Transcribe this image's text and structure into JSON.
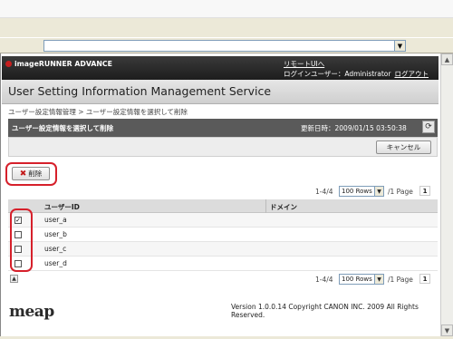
{
  "browser": {
    "address_value": ""
  },
  "header": {
    "logo": "imageRUNNER ADVANCE",
    "remote_link": "リモートUIへ",
    "login_label": "ログインユーザー：Administrator",
    "logout_link": "ログアウト"
  },
  "service_title": "User Setting Information Management Service",
  "breadcrumb": "ユーザー設定情報管理 > ユーザー設定情報を選択して削除",
  "panel": {
    "title": "ユーザー設定情報を選択して削除",
    "updated": "更新日時：2009/01/15 03:50:38",
    "cancel_label": "キャンセル"
  },
  "delete_label": "削除",
  "pager": {
    "range": "1-4/4",
    "rows": "100 Rows",
    "pages": "/1 Page",
    "current": "1"
  },
  "table": {
    "columns": [
      "ユーザーID",
      "ドメイン"
    ],
    "rows": [
      {
        "user_id": "user_a",
        "domain": "",
        "checked": "✓"
      },
      {
        "user_id": "user_b",
        "domain": "",
        "checked": ""
      },
      {
        "user_id": "user_c",
        "domain": "",
        "checked": ""
      },
      {
        "user_id": "user_d",
        "domain": "",
        "checked": ""
      }
    ]
  },
  "footer": {
    "brand": "meap",
    "copyright": "Version 1.0.0.14 Copyright CANON INC. 2009 All Rights Reserved."
  },
  "colors": {
    "highlight": "#d6202b",
    "header_bg": "#2a2a2a"
  },
  "icons": [
    "chevron-down-icon",
    "refresh-icon",
    "delete-x-icon",
    "sort-icon",
    "scroll-up-icon",
    "scroll-down-icon"
  ]
}
